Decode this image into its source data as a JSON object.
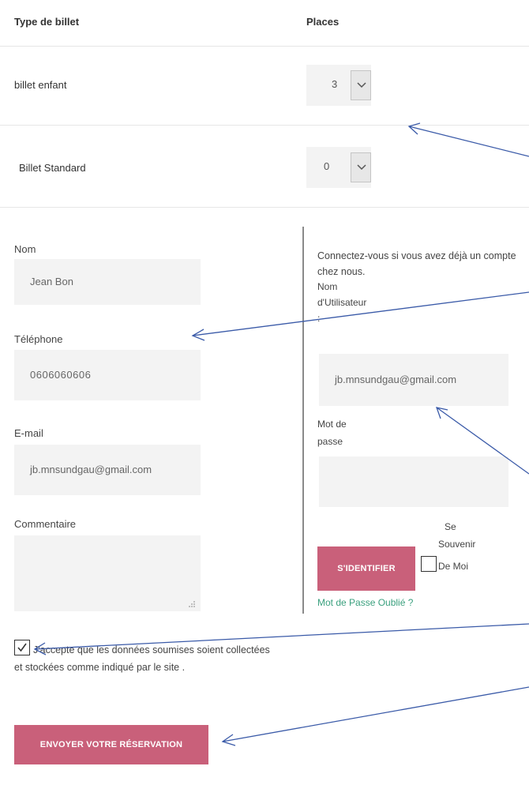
{
  "table": {
    "col_type": "Type de billet",
    "col_places": "Places",
    "rows": [
      {
        "label": "billet enfant",
        "qty": "3"
      },
      {
        "label": "Billet Standard",
        "qty": "0"
      }
    ]
  },
  "form": {
    "nom_label": "Nom",
    "nom_value": "Jean Bon",
    "tel_label": "Téléphone",
    "tel_value": "0606060606",
    "email_label": "E-mail",
    "email_value": "jb.mnsundgau@gmail.com",
    "comment_label": "Commentaire",
    "consent_text": "J'accepte que les données soumises soient collectées et stockées comme indiqué par le site .",
    "submit_label": "ENVOYER VOTRE RÉSERVATION"
  },
  "login": {
    "intro": "Connectez-vous si vous avez déjà un compte chez nous.",
    "username_label_1": "Nom",
    "username_label_2": "d'Utilisateur",
    "username_label_3": ":",
    "username_value": "jb.mnsundgau@gmail.com",
    "password_label_1": "Mot de",
    "password_label_2": "passe",
    "login_button": "S'IDENTIFIER",
    "remember_1": "Se",
    "remember_2": "Souvenir",
    "remember_3": "De Moi",
    "forgot": "Mot de Passe Oublié ?"
  },
  "colors": {
    "accent_pink": "#c9607a",
    "link_green": "#3aa07e",
    "arrow_blue": "#3a5aa8"
  }
}
